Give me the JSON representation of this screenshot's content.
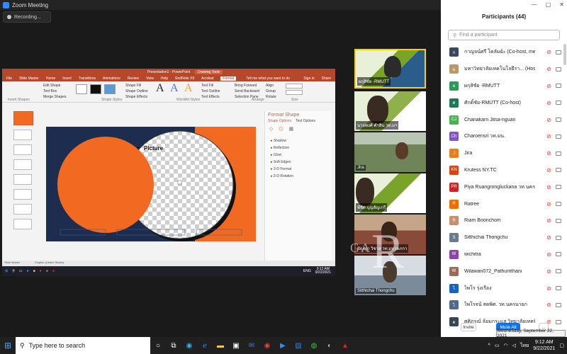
{
  "window": {
    "title": "Zoom Meeting",
    "recording": "Recording..."
  },
  "ppt": {
    "title": "Presentation1 - PowerPoint",
    "drawing_tools": "Drawing Tools",
    "tabs": [
      "File",
      "Slide Master",
      "Home",
      "Insert",
      "Transitions",
      "Animations",
      "Review",
      "View",
      "Help",
      "EndNote X9",
      "Acrobat",
      "Format"
    ],
    "tell_me": "Tell me what you want to do",
    "sign_in": "Sign in",
    "share": "Share",
    "ribbon": {
      "edit_shape": "Edit Shape",
      "text_box": "Text Box",
      "merge_shapes": "Merge Shapes",
      "insert_shapes": "Insert Shapes",
      "shape_styles": "Shape Styles",
      "shape_fill": "Shape Fill",
      "shape_outline": "Shape Outline",
      "shape_effects": "Shape Effects",
      "wordart_styles": "WordArt Styles",
      "text_fill": "Text Fill",
      "text_outline": "Text Outline",
      "text_effects": "Text Effects",
      "bring_forward": "Bring Forward",
      "send_backward": "Send Backward",
      "selection_pane": "Selection Pane",
      "align": "Align",
      "group": "Group",
      "rotate": "Rotate",
      "arrange": "Arrange",
      "size": "Size",
      "style_abc": "Abc",
      "wordart_a": "A"
    },
    "slide": {
      "placeholder": "Picture",
      "bg": "#1d2d50",
      "accent": "#f26a21"
    },
    "format_shape": {
      "title": "Format Shape",
      "shape_options": "Shape Options",
      "text_options": "Text Options",
      "items": [
        "Shadow",
        "Reflection",
        "Glow",
        "Soft Edges",
        "3-D Format",
        "3-D Rotation"
      ]
    },
    "status": {
      "view": "Slide Master",
      "lang": "English (United States)"
    },
    "clock": {
      "time": "9:12 AM",
      "date": "9/22/2021"
    },
    "ime": "ENG"
  },
  "videos": [
    {
      "label": "ผกุสิชัย -RMUTT",
      "bg": "#7aa32a"
    },
    {
      "label": "นายพงศ์ คำสิน วท.มฯ",
      "bg": "#8fb04a"
    },
    {
      "label": "Jira",
      "bg": "#6f8458"
    },
    {
      "label": "พีชิต  บุญสัญเกรี",
      "bg": "#7aa32a"
    },
    {
      "label": "ปัญญา วิชาล วท.มหาดภกา",
      "bg": "#a33a3a"
    },
    {
      "label": "Sitthichai Thongchu",
      "bg": "#7c8b99"
    }
  ],
  "participants": {
    "title": "Participants (44)",
    "search_placeholder": "Find a participant",
    "rows": [
      {
        "initial": "ก",
        "name": "กาญจน์ศรี โคลัมย์ะ (Co-host, me)",
        "color": "#3b4a5a",
        "host": false
      },
      {
        "initial": "ม",
        "name": "มหาวิทยาลัยเทคโนโลยีรา... (Host)",
        "color": "#b89a6a",
        "host": true
      },
      {
        "initial": "ผ",
        "name": "ผกุสิชัย -RMUTT",
        "color": "#2e9a5a",
        "host": false
      },
      {
        "initial": "ศ",
        "name": "ศักดิ์ชัย-RMUTT (Co-host)",
        "color": "#1e7a55",
        "host": false
      },
      {
        "initial": "CJ",
        "name": "Chanakarn Jitsa-nguan",
        "color": "#4caf50",
        "host": false
      },
      {
        "initial": "Ch",
        "name": "Charoensri วท.มน.",
        "color": "#7e57c2",
        "host": false
      },
      {
        "initial": "J",
        "name": "Jira",
        "color": "#e67e22",
        "host": false
      },
      {
        "initial": "KN",
        "name": "Krutess NY.TC",
        "color": "#d84315",
        "host": false
      },
      {
        "initial": "PR",
        "name": "Piya Ruangrongluckana วท.นครนายก",
        "color": "#c62828",
        "host": false
      },
      {
        "initial": "R",
        "name": "Ratree",
        "color": "#ef6c00",
        "host": false
      },
      {
        "initial": "R",
        "name": "Riam Boonchom",
        "color": "#c88e6e",
        "host": false
      },
      {
        "initial": "S",
        "name": "Sitthichai Thongchu",
        "color": "#6a7b8c",
        "host": false
      },
      {
        "initial": "W",
        "name": "wichitra",
        "color": "#8e44ad",
        "host": false
      },
      {
        "initial": "W",
        "name": "Wilawan072_Pathumthani",
        "color": "#9c6b55",
        "host": false
      },
      {
        "initial": "ไ",
        "name": "ไพโร รุ่งเรือง",
        "color": "#1565c0",
        "host": false
      },
      {
        "initial": "ไ",
        "name": "ไพโรจน์ สดพิศ. วท.นครนายก",
        "color": "#4e6b8a",
        "host": false
      },
      {
        "initial": "ค",
        "name": "ศศิภรณ์ ล้อมกระแส วิทยาลัยเทคนิค...",
        "color": "#37474f",
        "host": false
      }
    ],
    "invite": "Invite",
    "mute_all": "Mute All",
    "more": "..."
  },
  "tooltip": "Wednesday, September 22, 2021",
  "taskbar": {
    "search": "Type here to search",
    "time": "9:12 AM",
    "date": "9/22/2021",
    "lang": "ไทย"
  },
  "watermark": {
    "text1": "GA",
    "text2": "R"
  }
}
